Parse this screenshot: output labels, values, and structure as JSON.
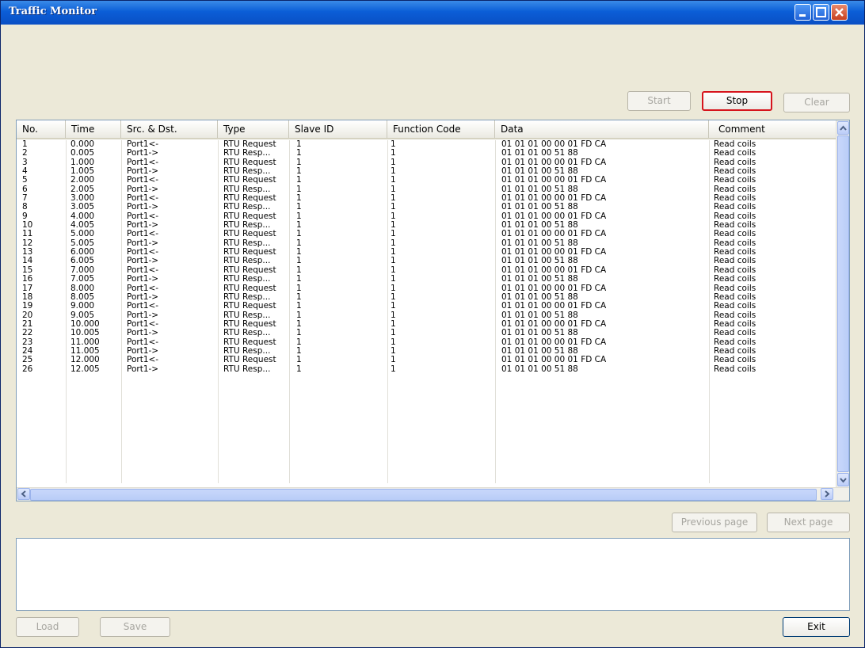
{
  "window": {
    "title": "Traffic Monitor"
  },
  "toolbar": {
    "start_label": "Start",
    "stop_label": "Stop",
    "clear_label": "Clear"
  },
  "table": {
    "columns": [
      "No.",
      "Time",
      "Src. & Dst.",
      "Type",
      "Slave ID",
      "Function Code",
      "Data",
      "Comment"
    ],
    "rows": [
      [
        "1",
        "0.000",
        "Port1<-",
        "RTU Request",
        "1",
        "1",
        "01 01 01 00 00 01 FD CA",
        "Read coils"
      ],
      [
        "2",
        "0.005",
        "Port1->",
        "RTU Resp...",
        "1",
        "1",
        "01 01 01 00 51 88",
        "Read coils"
      ],
      [
        "3",
        "1.000",
        "Port1<-",
        "RTU Request",
        "1",
        "1",
        "01 01 01 00 00 01 FD CA",
        "Read coils"
      ],
      [
        "4",
        "1.005",
        "Port1->",
        "RTU Resp...",
        "1",
        "1",
        "01 01 01 00 51 88",
        "Read coils"
      ],
      [
        "5",
        "2.000",
        "Port1<-",
        "RTU Request",
        "1",
        "1",
        "01 01 01 00 00 01 FD CA",
        "Read coils"
      ],
      [
        "6",
        "2.005",
        "Port1->",
        "RTU Resp...",
        "1",
        "1",
        "01 01 01 00 51 88",
        "Read coils"
      ],
      [
        "7",
        "3.000",
        "Port1<-",
        "RTU Request",
        "1",
        "1",
        "01 01 01 00 00 01 FD CA",
        "Read coils"
      ],
      [
        "8",
        "3.005",
        "Port1->",
        "RTU Resp...",
        "1",
        "1",
        "01 01 01 00 51 88",
        "Read coils"
      ],
      [
        "9",
        "4.000",
        "Port1<-",
        "RTU Request",
        "1",
        "1",
        "01 01 01 00 00 01 FD CA",
        "Read coils"
      ],
      [
        "10",
        "4.005",
        "Port1->",
        "RTU Resp...",
        "1",
        "1",
        "01 01 01 00 51 88",
        "Read coils"
      ],
      [
        "11",
        "5.000",
        "Port1<-",
        "RTU Request",
        "1",
        "1",
        "01 01 01 00 00 01 FD CA",
        "Read coils"
      ],
      [
        "12",
        "5.005",
        "Port1->",
        "RTU Resp...",
        "1",
        "1",
        "01 01 01 00 51 88",
        "Read coils"
      ],
      [
        "13",
        "6.000",
        "Port1<-",
        "RTU Request",
        "1",
        "1",
        "01 01 01 00 00 01 FD CA",
        "Read coils"
      ],
      [
        "14",
        "6.005",
        "Port1->",
        "RTU Resp...",
        "1",
        "1",
        "01 01 01 00 51 88",
        "Read coils"
      ],
      [
        "15",
        "7.000",
        "Port1<-",
        "RTU Request",
        "1",
        "1",
        "01 01 01 00 00 01 FD CA",
        "Read coils"
      ],
      [
        "16",
        "7.005",
        "Port1->",
        "RTU Resp...",
        "1",
        "1",
        "01 01 01 00 51 88",
        "Read coils"
      ],
      [
        "17",
        "8.000",
        "Port1<-",
        "RTU Request",
        "1",
        "1",
        "01 01 01 00 00 01 FD CA",
        "Read coils"
      ],
      [
        "18",
        "8.005",
        "Port1->",
        "RTU Resp...",
        "1",
        "1",
        "01 01 01 00 51 88",
        "Read coils"
      ],
      [
        "19",
        "9.000",
        "Port1<-",
        "RTU Request",
        "1",
        "1",
        "01 01 01 00 00 01 FD CA",
        "Read coils"
      ],
      [
        "20",
        "9.005",
        "Port1->",
        "RTU Resp...",
        "1",
        "1",
        "01 01 01 00 51 88",
        "Read coils"
      ],
      [
        "21",
        "10.000",
        "Port1<-",
        "RTU Request",
        "1",
        "1",
        "01 01 01 00 00 01 FD CA",
        "Read coils"
      ],
      [
        "22",
        "10.005",
        "Port1->",
        "RTU Resp...",
        "1",
        "1",
        "01 01 01 00 51 88",
        "Read coils"
      ],
      [
        "23",
        "11.000",
        "Port1<-",
        "RTU Request",
        "1",
        "1",
        "01 01 01 00 00 01 FD CA",
        "Read coils"
      ],
      [
        "24",
        "11.005",
        "Port1->",
        "RTU Resp...",
        "1",
        "1",
        "01 01 01 00 51 88",
        "Read coils"
      ],
      [
        "25",
        "12.000",
        "Port1<-",
        "RTU Request",
        "1",
        "1",
        "01 01 01 00 00 01 FD CA",
        "Read coils"
      ],
      [
        "26",
        "12.005",
        "Port1->",
        "RTU Resp...",
        "1",
        "1",
        "01 01 01 00 51 88",
        "Read coils"
      ]
    ]
  },
  "paging": {
    "previous_label": "Previous page",
    "next_label": "Next page"
  },
  "footer": {
    "load_label": "Load",
    "save_label": "Save",
    "exit_label": "Exit"
  },
  "colors": {
    "titlebar": "#0b5ed7",
    "stop_highlight": "#d6141c",
    "window_bg": "#ece9d8"
  }
}
